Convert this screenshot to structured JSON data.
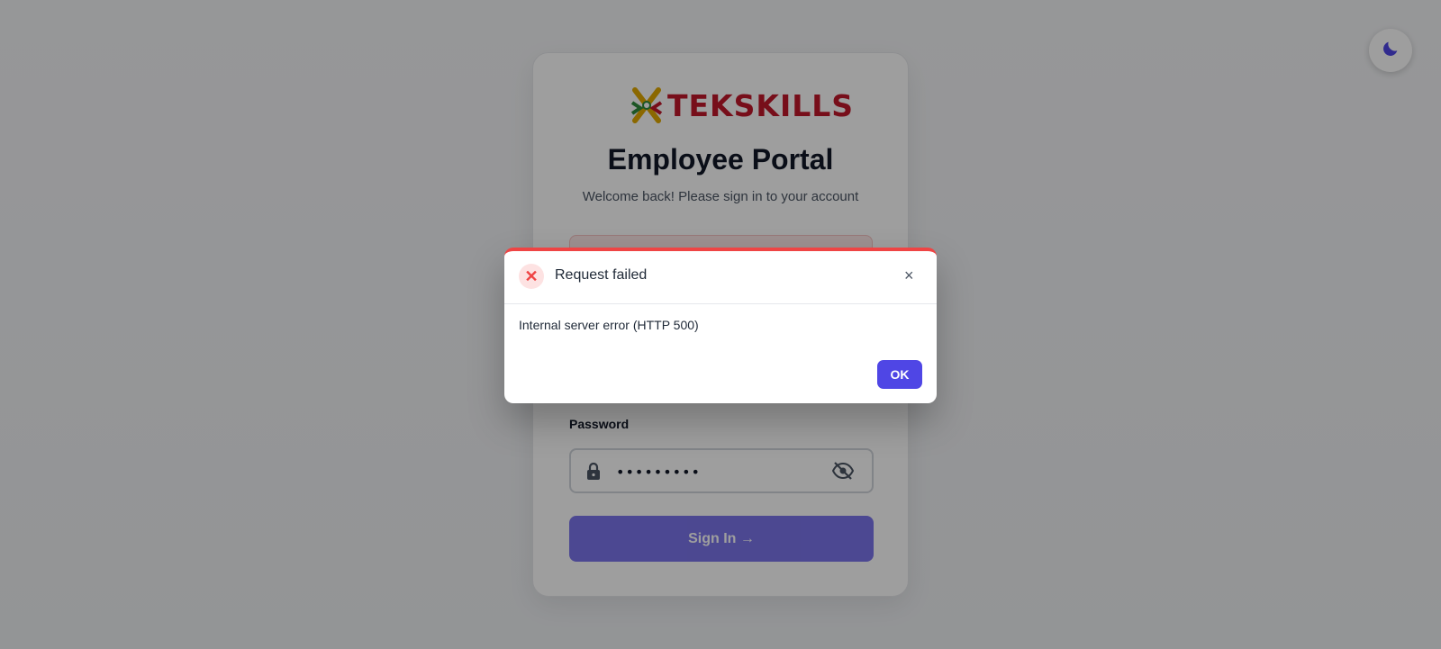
{
  "brand": {
    "name": "TEKSKILLS",
    "accent": "#c0172b"
  },
  "page": {
    "title": "Employee Portal",
    "subtitle": "Welcome back! Please sign in to your account"
  },
  "form": {
    "password_label": "Password",
    "password_value": "•••••••••",
    "submit_label": "Sign In →",
    "icons": {
      "lock": "lock-icon",
      "visibility": "eye-off-icon"
    }
  },
  "theme_toggle": {
    "icon": "moon-icon"
  },
  "modal": {
    "title": "Request failed",
    "message": "Internal server error (HTTP 500)",
    "ok_label": "OK",
    "close_glyph": "×",
    "error_glyph": "✕",
    "accent": "#ef4444"
  },
  "colors": {
    "primary": "#4f46e5",
    "danger": "#ef4444"
  }
}
